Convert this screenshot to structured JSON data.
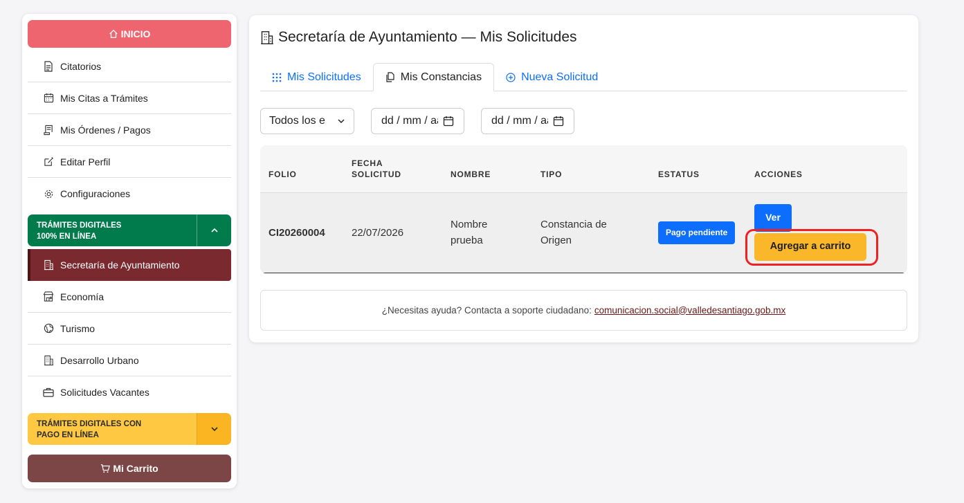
{
  "sidebar": {
    "inicio": "INICIO",
    "menu": [
      {
        "label": "Citatorios",
        "icon": "document-icon"
      },
      {
        "label": "Mis Citas a Trámites",
        "icon": "calendar-icon"
      },
      {
        "label": "Mis Órdenes / Pagos",
        "icon": "receipt-icon"
      },
      {
        "label": "Editar Perfil",
        "icon": "edit-icon"
      },
      {
        "label": "Configuraciones",
        "icon": "gear-icon"
      }
    ],
    "group_online": "TRÁMITES DIGITALES 100% EN LÍNEA",
    "group_online_line1": "TRÁMITES DIGITALES",
    "group_online_line2": "100% EN LÍNEA",
    "online_items": [
      {
        "label": "Secretaría de Ayuntamiento",
        "icon": "building-icon",
        "active": true
      },
      {
        "label": "Economía",
        "icon": "store-icon"
      },
      {
        "label": "Turismo",
        "icon": "globe-icon"
      },
      {
        "label": "Desarrollo Urbano",
        "icon": "building-icon"
      },
      {
        "label": "Solicitudes Vacantes",
        "icon": "briefcase-icon"
      }
    ],
    "group_pay_line1": "TRÁMITES DIGITALES CON",
    "group_pay_line2": "PAGO EN LÍNEA",
    "cart": "Mi Carrito"
  },
  "main": {
    "title": "Secretaría de Ayuntamiento — Mis Solicitudes",
    "tabs": [
      {
        "label": "Mis Solicitudes",
        "icon": "grid-icon"
      },
      {
        "label": "Mis Constancias",
        "icon": "copy-icon",
        "active": true
      },
      {
        "label": "Nueva Solicitud",
        "icon": "plus-circle-icon"
      }
    ],
    "filters": {
      "status": "Todos los e",
      "date_from": "dd / mm / aa",
      "date_to": "dd / mm / aa"
    },
    "table": {
      "headers": {
        "folio": "FOLIO",
        "fecha_1": "FECHA",
        "fecha_2": "SOLICITUD",
        "nombre": "NOMBRE",
        "tipo": "TIPO",
        "estatus": "ESTATUS",
        "acciones": "ACCIONES"
      },
      "rows": [
        {
          "folio": "CI20260004",
          "fecha": "22/07/2026",
          "nombre": "Nombre prueba",
          "tipo": "Constancia de Origen",
          "estatus": "Pago pendiente",
          "ver": "Ver",
          "agregar": "Agregar a carrito"
        }
      ]
    },
    "help": {
      "text": "¿Necesitas ayuda? Contacta a soporte ciudadano:",
      "email": "comunicacion.social@valledesantiago.gob.mx"
    }
  },
  "colors": {
    "inicio": "#ee6570",
    "green": "#017a4c",
    "yellow": "#fec843",
    "active": "#7a2a2e",
    "cart": "#7b4645",
    "blue": "#0d6efd",
    "add_button": "#fbb72a",
    "highlight": "#ee2222"
  }
}
